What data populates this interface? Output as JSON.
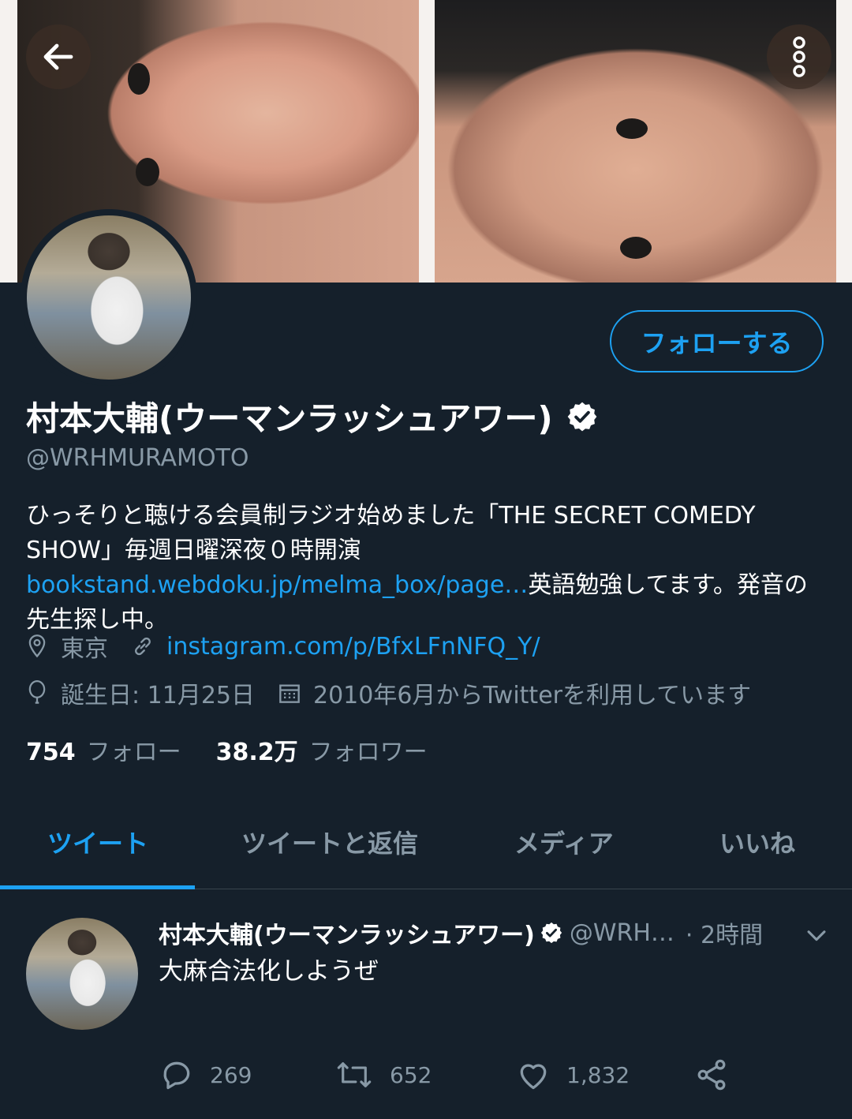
{
  "header": {
    "icons": {
      "back": "arrow-left-icon",
      "more": "more-vertical-icon"
    }
  },
  "profile": {
    "follow_button": "フォローする",
    "name": "村本大輔(ウーマンラッシュアワー)",
    "handle": "@WRHMURAMOTO",
    "bio_text_1": "ひっそりと聴ける会員制ラジオ始めました「THE SECRET COMEDY SHOW」毎週日曜深夜０時開演 ",
    "bio_link": "bookstand.webdoku.jp/melma_box/page…",
    "bio_text_2": "英語勉強してます。発音の先生探し中。",
    "location": "東京",
    "website": "instagram.com/p/BfxLFnNFQ_Y/",
    "birthday": "誕生日: 11月25日",
    "joined": "2010年6月からTwitterを利用しています",
    "following_count": "754",
    "following_label": "フォロー",
    "followers_count": "38.2万",
    "followers_label": "フォロワー"
  },
  "tabs": [
    {
      "label": "ツイート",
      "active": true
    },
    {
      "label": "ツイートと返信",
      "active": false
    },
    {
      "label": "メディア",
      "active": false
    },
    {
      "label": "いいね",
      "active": false
    }
  ],
  "tweet": {
    "name": "村本大輔(ウーマンラッシュアワー)",
    "handle": "@WRH…",
    "time": "· 2時間",
    "text": "大麻合法化しようぜ",
    "replies": "269",
    "retweets": "652",
    "likes": "1,832"
  },
  "colors": {
    "background": "#15202b",
    "accent": "#1da1f2",
    "secondary_text": "#8899a6",
    "divider": "#38444d"
  }
}
